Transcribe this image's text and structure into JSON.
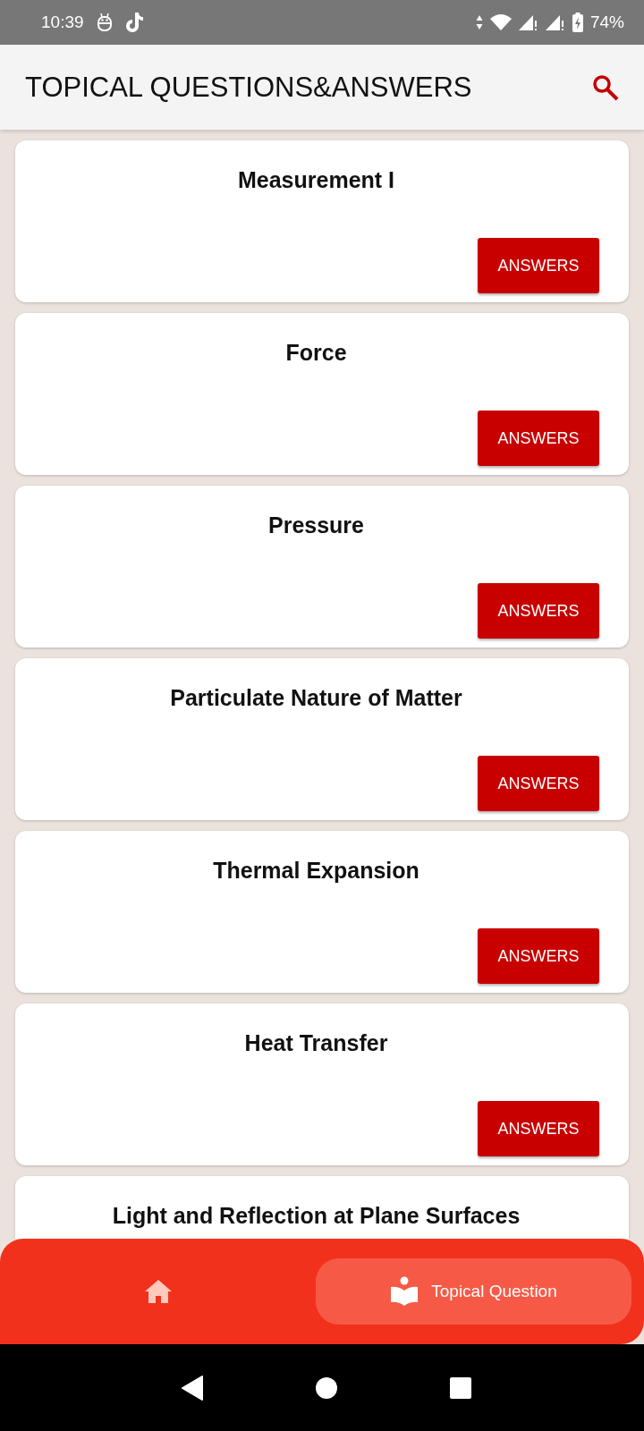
{
  "status_bar": {
    "time": "10:39",
    "battery": "74%"
  },
  "app_bar": {
    "title": "TOPICAL QUESTIONS&ANSWERS"
  },
  "topics": [
    {
      "title": "Measurement I",
      "button": "ANSWERS"
    },
    {
      "title": "Force",
      "button": "ANSWERS"
    },
    {
      "title": "Pressure",
      "button": "ANSWERS"
    },
    {
      "title": "Particulate Nature of Matter",
      "button": "ANSWERS"
    },
    {
      "title": "Thermal Expansion",
      "button": "ANSWERS"
    },
    {
      "title": "Heat Transfer",
      "button": "ANSWERS"
    },
    {
      "title": "Light and Reflection at Plane Surfaces"
    }
  ],
  "bottom_nav": [
    {
      "kind": "home",
      "selected": false
    },
    {
      "kind": "reader",
      "label": "Topical Question",
      "selected": true
    }
  ]
}
